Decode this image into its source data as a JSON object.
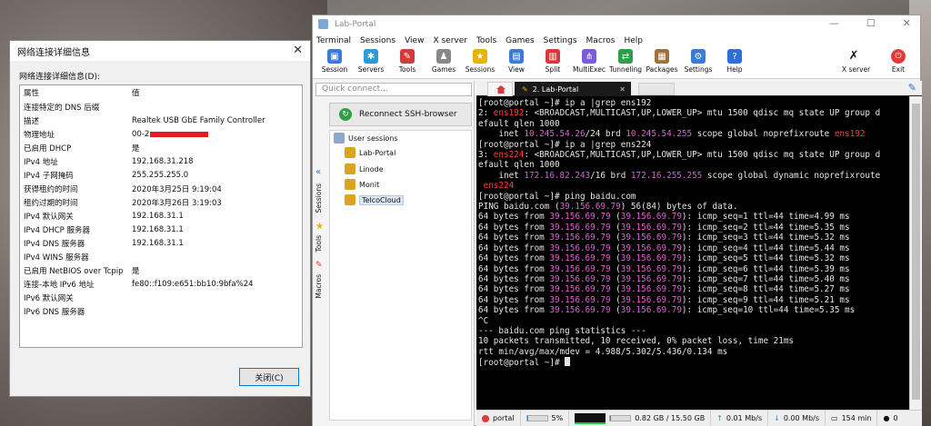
{
  "dialog": {
    "title": "网络连接详细信息",
    "label": "网络连接详细信息(D):",
    "header": {
      "k": "属性",
      "v": "值"
    },
    "rows": [
      {
        "k": "连接特定的 DNS 后缀",
        "v": ""
      },
      {
        "k": "描述",
        "v": "Realtek USB GbE Family Controller"
      },
      {
        "k": "物理地址",
        "v": "00-2"
      },
      {
        "k": "已启用 DHCP",
        "v": "是"
      },
      {
        "k": "IPv4 地址",
        "v": "192.168.31.218"
      },
      {
        "k": "IPv4 子网掩码",
        "v": "255.255.255.0"
      },
      {
        "k": "获得租约的时间",
        "v": "2020年3月25日 9:19:04"
      },
      {
        "k": "租约过期的时间",
        "v": "2020年3月26日 3:19:03"
      },
      {
        "k": "IPv4 默认网关",
        "v": "192.168.31.1"
      },
      {
        "k": "IPv4 DHCP 服务器",
        "v": "192.168.31.1"
      },
      {
        "k": "IPv4 DNS 服务器",
        "v": "192.168.31.1"
      },
      {
        "k": "IPv4 WINS 服务器",
        "v": ""
      },
      {
        "k": "已启用 NetBIOS over Tcpip",
        "v": "是"
      },
      {
        "k": "连接-本地 IPv6 地址",
        "v": "fe80::f109:e651:bb10:9bfa%24"
      },
      {
        "k": "IPv6 默认网关",
        "v": ""
      },
      {
        "k": "IPv6 DNS 服务器",
        "v": ""
      }
    ],
    "close_label": "关闭(C)",
    "close_icon": "✕"
  },
  "moba": {
    "title": "Lab-Portal",
    "menu": [
      "Terminal",
      "Sessions",
      "View",
      "X server",
      "Tools",
      "Games",
      "Settings",
      "Macros",
      "Help"
    ],
    "toolbar": [
      {
        "label": "Session",
        "color": "#3a7bd5",
        "glyph": "▣"
      },
      {
        "label": "Servers",
        "color": "#2d9bd6",
        "glyph": "✱"
      },
      {
        "label": "Tools",
        "color": "#d33b3b",
        "glyph": "✎"
      },
      {
        "label": "Games",
        "color": "#888888",
        "glyph": "♟"
      },
      {
        "label": "Sessions",
        "color": "#e6b400",
        "glyph": "★"
      },
      {
        "label": "View",
        "color": "#3a7bd5",
        "glyph": "▤"
      },
      {
        "label": "Split",
        "color": "#d33b3b",
        "glyph": "▥"
      },
      {
        "label": "MultiExec",
        "color": "#7a5cd6",
        "glyph": "⋔"
      },
      {
        "label": "Tunneling",
        "color": "#2e9e4a",
        "glyph": "⇄"
      },
      {
        "label": "Packages",
        "color": "#a0703a",
        "glyph": "▦"
      },
      {
        "label": "Settings",
        "color": "#3a7bd5",
        "glyph": "⚙"
      },
      {
        "label": "Help",
        "color": "#2d6fd6",
        "glyph": "?"
      }
    ],
    "xserver_label": "X server",
    "exit_label": "Exit",
    "quick_connect": "Quick connect...",
    "ssh_browser": "Reconnect SSH-browser",
    "side_tabs": [
      "Sessions",
      "Tools",
      "Macros"
    ],
    "tree": {
      "root": "User sessions",
      "items": [
        "Lab-Portal",
        "Linode",
        "Monit",
        "TelcoCloud"
      ]
    },
    "active_tab": "2. Lab-Portal",
    "status": {
      "host": "portal",
      "cpu": "5%",
      "memory": "0.82 GB / 15.50 GB",
      "upload": "0.01 Mb/s",
      "download": "0.00 Mb/s",
      "uptime": "154 min",
      "users": "0"
    }
  },
  "terminal": {
    "lines": [
      [
        {
          "t": "[root@portal ~]# ip a |grep ens192"
        }
      ],
      [
        {
          "t": "2: "
        },
        {
          "t": "ens192",
          "c": "r"
        },
        {
          "t": ": <BROADCAST,MULTICAST,UP,LOWER_UP> mtu 1500 qdisc mq state UP group d"
        }
      ],
      [
        {
          "t": "efault qlen 1000"
        }
      ],
      [
        {
          "t": "    inet "
        },
        {
          "t": "10.245.54.26",
          "c": "m"
        },
        {
          "t": "/24 brd "
        },
        {
          "t": "10.245.54.255",
          "c": "m"
        },
        {
          "t": " scope global noprefixroute "
        },
        {
          "t": "ens192",
          "c": "r"
        }
      ],
      [
        {
          "t": "[root@portal ~]# ip a |grep ens224"
        }
      ],
      [
        {
          "t": "3: "
        },
        {
          "t": "ens224",
          "c": "r"
        },
        {
          "t": ": <BROADCAST,MULTICAST,UP,LOWER_UP> mtu 1500 qdisc mq state UP group d"
        }
      ],
      [
        {
          "t": "efault qlen 1000"
        }
      ],
      [
        {
          "t": "    inet "
        },
        {
          "t": "172.16.82.243",
          "c": "m"
        },
        {
          "t": "/16 brd "
        },
        {
          "t": "172.16.255.255",
          "c": "m"
        },
        {
          "t": " scope global dynamic noprefixroute"
        }
      ],
      [
        {
          "t": " "
        },
        {
          "t": "ens224",
          "c": "r"
        }
      ],
      [
        {
          "t": "[root@portal ~]# ping baidu.com"
        }
      ],
      [
        {
          "t": "PING baidu.com ("
        },
        {
          "t": "39.156.69.79",
          "c": "m"
        },
        {
          "t": ") 56(84) bytes of data."
        }
      ],
      [
        {
          "t": "64 bytes from "
        },
        {
          "t": "39.156.69.79",
          "c": "m"
        },
        {
          "t": " ("
        },
        {
          "t": "39.156.69.79",
          "c": "m"
        },
        {
          "t": "): icmp_seq=1 ttl=44 time=4.99 ms"
        }
      ],
      [
        {
          "t": "64 bytes from "
        },
        {
          "t": "39.156.69.79",
          "c": "m"
        },
        {
          "t": " ("
        },
        {
          "t": "39.156.69.79",
          "c": "m"
        },
        {
          "t": "): icmp_seq=2 ttl=44 time=5.35 ms"
        }
      ],
      [
        {
          "t": "64 bytes from "
        },
        {
          "t": "39.156.69.79",
          "c": "m"
        },
        {
          "t": " ("
        },
        {
          "t": "39.156.69.79",
          "c": "m"
        },
        {
          "t": "): icmp_seq=3 ttl=44 time=5.32 ms"
        }
      ],
      [
        {
          "t": "64 bytes from "
        },
        {
          "t": "39.156.69.79",
          "c": "m"
        },
        {
          "t": " ("
        },
        {
          "t": "39.156.69.79",
          "c": "m"
        },
        {
          "t": "): icmp_seq=4 ttl=44 time=5.44 ms"
        }
      ],
      [
        {
          "t": "64 bytes from "
        },
        {
          "t": "39.156.69.79",
          "c": "m"
        },
        {
          "t": " ("
        },
        {
          "t": "39.156.69.79",
          "c": "m"
        },
        {
          "t": "): icmp_seq=5 ttl=44 time=5.32 ms"
        }
      ],
      [
        {
          "t": "64 bytes from "
        },
        {
          "t": "39.156.69.79",
          "c": "m"
        },
        {
          "t": " ("
        },
        {
          "t": "39.156.69.79",
          "c": "m"
        },
        {
          "t": "): icmp_seq=6 ttl=44 time=5.39 ms"
        }
      ],
      [
        {
          "t": "64 bytes from "
        },
        {
          "t": "39.156.69.79",
          "c": "m"
        },
        {
          "t": " ("
        },
        {
          "t": "39.156.69.79",
          "c": "m"
        },
        {
          "t": "): icmp_seq=7 ttl=44 time=5.40 ms"
        }
      ],
      [
        {
          "t": "64 bytes from "
        },
        {
          "t": "39.156.69.79",
          "c": "m"
        },
        {
          "t": " ("
        },
        {
          "t": "39.156.69.79",
          "c": "m"
        },
        {
          "t": "): icmp_seq=8 ttl=44 time=5.27 ms"
        }
      ],
      [
        {
          "t": "64 bytes from "
        },
        {
          "t": "39.156.69.79",
          "c": "m"
        },
        {
          "t": " ("
        },
        {
          "t": "39.156.69.79",
          "c": "m"
        },
        {
          "t": "): icmp_seq=9 ttl=44 time=5.21 ms"
        }
      ],
      [
        {
          "t": "64 bytes from "
        },
        {
          "t": "39.156.69.79",
          "c": "m"
        },
        {
          "t": " ("
        },
        {
          "t": "39.156.69.79",
          "c": "m"
        },
        {
          "t": "): icmp_seq=10 ttl=44 time=5.35 ms"
        }
      ],
      [
        {
          "t": "^C"
        }
      ],
      [
        {
          "t": "--- baidu.com ping statistics ---"
        }
      ],
      [
        {
          "t": "10 packets transmitted, 10 received, 0% packet loss, time 21ms"
        }
      ],
      [
        {
          "t": "rtt min/avg/max/mdev = 4.988/5.302/5.436/0.134 ms"
        }
      ],
      [
        {
          "t": "[root@portal ~]# "
        }
      ]
    ]
  }
}
